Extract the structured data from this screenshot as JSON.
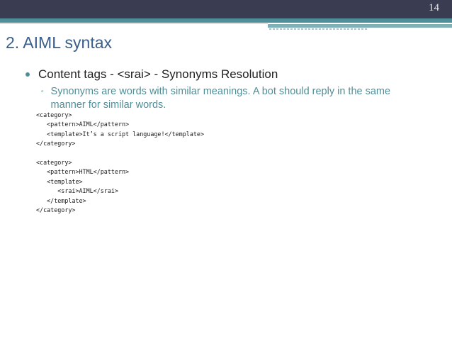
{
  "slide": {
    "number": "14",
    "title": "2. AIML syntax"
  },
  "content": {
    "bullet": "Content tags - <srai> - Synonyms Resolution",
    "sub_bullet": "Synonyms are words with similar meanings. A bot should reply in the same manner for similar words."
  },
  "code": {
    "lines": [
      "<category>",
      "   <pattern>AIML</pattern>",
      "   <template>It’s a script language!</template>",
      "</category>",
      "",
      "<category>",
      "   <pattern>HTML</pattern>",
      "   <template>",
      "      <srai>AIML</srai>",
      "   </template>",
      "</category>"
    ]
  },
  "colors": {
    "topbar": "#3a3d52",
    "accent_teal": "#4f8f99",
    "title_blue": "#3a5f8a"
  }
}
